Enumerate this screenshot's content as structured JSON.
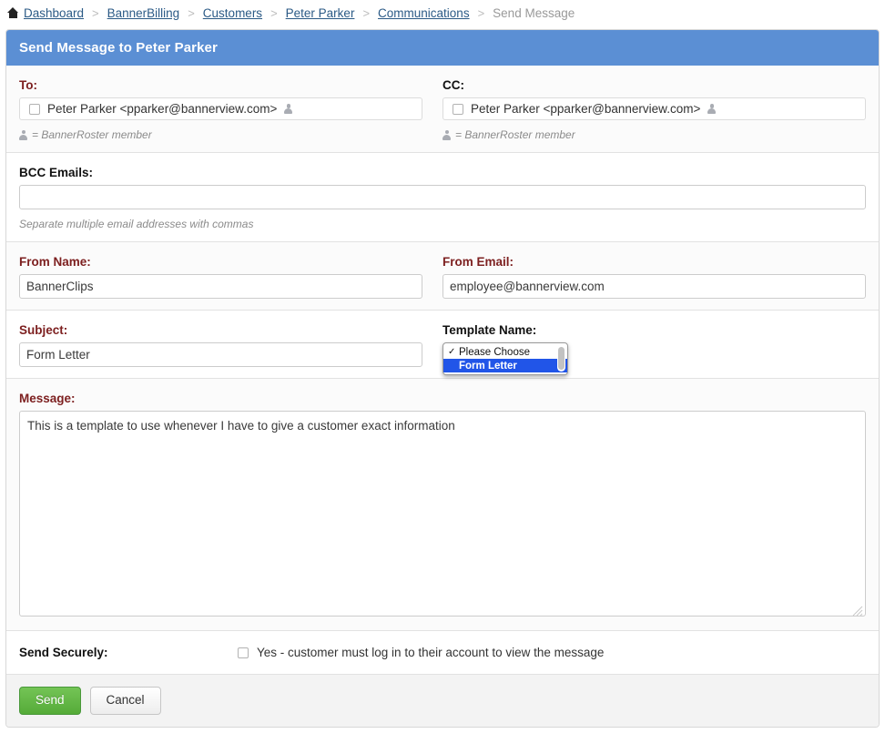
{
  "breadcrumb": {
    "home_icon": "home-icon",
    "items": [
      {
        "label": "Dashboard",
        "current": false
      },
      {
        "label": "BannerBilling",
        "current": false
      },
      {
        "label": "Customers",
        "current": false
      },
      {
        "label": "Peter Parker",
        "current": false
      },
      {
        "label": "Communications",
        "current": false
      },
      {
        "label": "Send Message",
        "current": true
      }
    ],
    "separator": ">"
  },
  "panel": {
    "header_title": "Send Message to Peter Parker",
    "header_color": "#5b8fd4"
  },
  "to": {
    "label": "To:",
    "recipient": "Peter Parker <pparker@bannerview.com>",
    "checked": false,
    "roster_icon": "person-icon",
    "hint": "= BannerRoster member"
  },
  "cc": {
    "label": "CC:",
    "recipient": "Peter Parker <pparker@bannerview.com>",
    "checked": false,
    "roster_icon": "person-icon",
    "hint": "= BannerRoster member"
  },
  "bcc": {
    "label": "BCC Emails:",
    "value": "",
    "placeholder": "",
    "hint": "Separate multiple email addresses with commas"
  },
  "from_name": {
    "label": "From Name:",
    "value": "BannerClips"
  },
  "from_email": {
    "label": "From Email:",
    "value": "employee@bannerview.com"
  },
  "subject": {
    "label": "Subject:",
    "value": "Form Letter"
  },
  "template": {
    "label": "Template Name:",
    "expanded": true,
    "options": [
      {
        "label": "Please Choose",
        "checked": true,
        "highlighted": false
      },
      {
        "label": "Form Letter",
        "checked": false,
        "highlighted": true
      }
    ],
    "highlight_color": "#2155e8",
    "scrollbar": "dropdown-scrollbar"
  },
  "message": {
    "label": "Message:",
    "value": "This is a template to use whenever I have to give a customer exact information",
    "placeholder": ""
  },
  "send_securely": {
    "label": "Send Securely:",
    "option_label": "Yes - customer must log in to their account to view the message",
    "checked": false
  },
  "footer": {
    "send_label": "Send",
    "cancel_label": "Cancel",
    "send_color": "#55ab38"
  },
  "colors": {
    "required_label": "#7d2020",
    "link": "#2b5a86",
    "muted": "#999999"
  }
}
